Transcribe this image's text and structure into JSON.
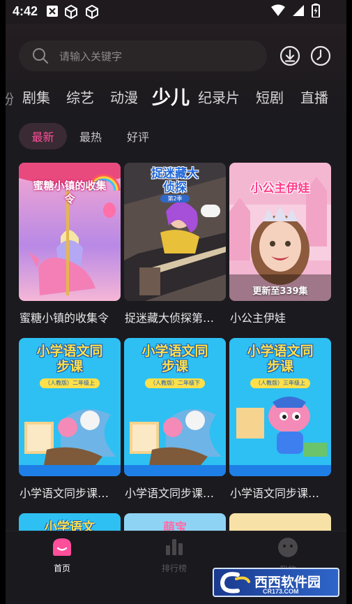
{
  "status_bar": {
    "time": "4:42"
  },
  "search": {
    "placeholder": "请输入关键字"
  },
  "categories": {
    "partial_prev": "纷",
    "items": [
      "剧集",
      "综艺",
      "动漫",
      "少儿",
      "纪录片",
      "短剧",
      "直播"
    ],
    "active": "少儿"
  },
  "filters": {
    "items": [
      "最新",
      "最热",
      "好评"
    ],
    "active": "最新"
  },
  "grid": {
    "rows": [
      [
        {
          "title": "蜜糖小镇的收集令",
          "poster_text": "蜜糖小镇的收集令",
          "badge": ""
        },
        {
          "title": "捉迷藏大侦探第…",
          "poster_text": "捉迷藏大侦探",
          "poster_sub": "第2季",
          "badge": ""
        },
        {
          "title": "小公主伊娃",
          "poster_text": "小公主伊娃",
          "badge": "更新至339集"
        }
      ],
      [
        {
          "title": "小学语文同步课…",
          "poster_text": "小学语文同步课",
          "poster_sub": "（人教版）二年级上",
          "badge": ""
        },
        {
          "title": "小学语文同步课…",
          "poster_text": "小学语文同步课",
          "poster_sub": "（人教版）二年级下",
          "badge": ""
        },
        {
          "title": "小学语文同步课…",
          "poster_text": "小学语文同步课",
          "poster_sub": "（人教版）三年级上",
          "badge": ""
        }
      ],
      [
        {
          "poster_text": "小学语文"
        },
        {
          "poster_text": "萌宝"
        },
        {
          "poster_text": ""
        }
      ]
    ]
  },
  "bottom_nav": {
    "items": [
      {
        "label": "首页",
        "icon": "home-icon",
        "active": true
      },
      {
        "label": "排行榜",
        "icon": "ranking-icon",
        "active": false
      },
      {
        "label": "我的",
        "icon": "profile-icon",
        "active": false
      }
    ]
  },
  "watermark": {
    "text": "西西软件园",
    "sub": "CR173.COM"
  },
  "colors": {
    "accent": "#ff4f9b",
    "background": "#1b1a1f",
    "chip_active_bg": "#3a2a33"
  }
}
